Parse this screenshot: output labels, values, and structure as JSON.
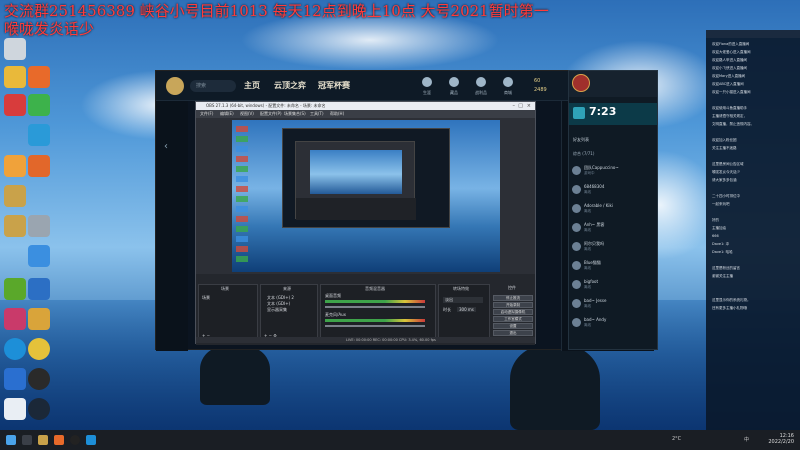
{
  "overlay": {
    "line1": "交流群251456389 峡谷小号目前1013 每天12点到晚上10点 大号2021暂时第一",
    "line2": "喉咙发炎话少"
  },
  "client": {
    "search_placeholder": "搜索",
    "nav": [
      "主页",
      "云顶之弈",
      "冠军杯赛"
    ],
    "top_icons": [
      "生涯",
      "藏品",
      "战利品",
      "商城"
    ],
    "currency_a": "60",
    "currency_b": "2489"
  },
  "obs": {
    "title": "OBS 27.1.3 (64-bit, windows) - 配置文件: 未命名 - 场景: 未命名",
    "menu": [
      "文件(F)",
      "编辑(E)",
      "视图(V)",
      "配置文件(P)",
      "场景集合(S)",
      "工具(T)",
      "帮助(H)"
    ],
    "scenes_header": "场景",
    "sources_header": "来源",
    "mixer_header": "音频混音器",
    "transitions_header": "转场特效",
    "controls_header": "控件",
    "scene_item": "场景",
    "sources": [
      "文本 (GDI+) 2",
      "文本 (GDI+)",
      "显示器采集"
    ],
    "mixer_rows": [
      "桌面音频",
      "麦克风/Aux"
    ],
    "fade": "淡出",
    "duration_label": "时长",
    "duration": "300 ms",
    "buttons": [
      "停止推流",
      "开始录制",
      "启动虚拟摄像机",
      "工作室模式",
      "设置",
      "退出"
    ],
    "status": "LIVE: 00:00:00  REC: 00:00:00  CPU: 3.4%, 60.00 fps"
  },
  "chat": {
    "time": "7:23",
    "header": "好友列表",
    "group": "综合 (7/71)",
    "friends": [
      {
        "name": "团队Cappuccino~",
        "status": "游戏中"
      },
      {
        "name": "68468304",
        "status": "离线"
      },
      {
        "name": "Adorable / Kiki",
        "status": "离线"
      },
      {
        "name": "Anh~ 黑客",
        "status": "离线"
      },
      {
        "name": "阿尔贝我吗",
        "status": "离线"
      },
      {
        "name": "Blue猫猫",
        "status": "离线"
      },
      {
        "name": "bigfoot",
        "status": "离线"
      },
      {
        "name": "bad~ Jesse",
        "status": "离线"
      },
      {
        "name": "bad~ Andy",
        "status": "离线"
      }
    ]
  },
  "right_panel": {
    "lines": [
      "欢迎Fiona的进入直播间",
      "欢迎大佬爱心进入直播间",
      "欢迎路人甲进入直播间",
      "欢迎小飞侠进入直播间",
      "欢迎Mary进入直播间",
      "欢迎ABC进入直播间",
      "欢迎一只小猫进入直播间",
      "",
      "欢迎使用斗鱼直播助手",
      "主播请遵守相关规定，",
      "文明直播，禁止违规内容。",
      "",
      "欢迎加入粉丝团",
      "关注主播不迷路",
      "",
      "这里是房间公告区域",
      "喉咙发炎今天话少",
      "请大家多多包涵",
      "",
      "二十四小时排位中",
      "一起来玩吧",
      "",
      "好的",
      "主播加油",
      "666",
      "Dave1: 冲",
      "Dave1: 哈哈",
      "",
      "这里是粉丝的留言",
      "谢谢关注主播",
      "",
      "",
      "这里显示你的系统礼物。",
      "还有更多主播小礼物哦"
    ]
  },
  "taskbar": {
    "time": "12:16",
    "date": "2022/2/20",
    "weather": "2°C",
    "lang": "中"
  },
  "colors": {
    "overlay_text": "#ff3b3b",
    "accent_gold": "#c8a65a",
    "time_bar": "#0c3a48"
  }
}
